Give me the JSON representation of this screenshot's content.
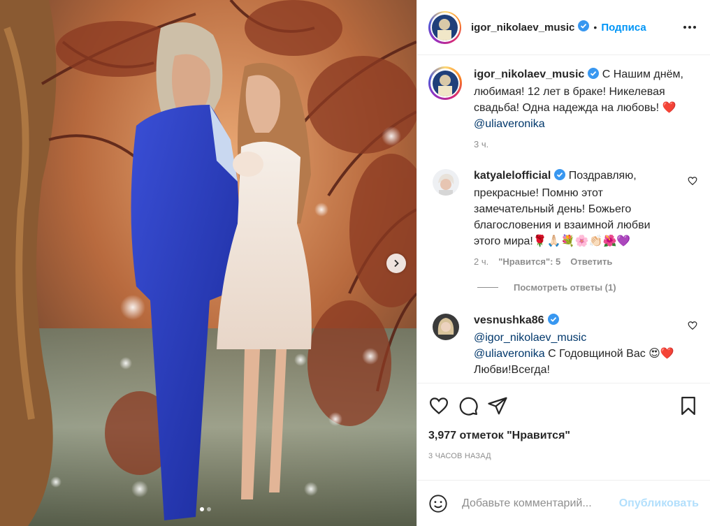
{
  "post": {
    "author": "igor_nikolaev_music",
    "follow_label": "Подписа",
    "bullet": "•",
    "caption": {
      "username": "igor_nikolaev_music",
      "text": " С Нашим днём, любимая! 12 лет в браке! Никелевая свадьба! Одна надежда на любовь! ❤️ ",
      "mention": "@uliaveronika",
      "time": "3 ч."
    },
    "comments": [
      {
        "username": "katyalelofficial",
        "text": " Поздравляю, прекрасные! Помню этот замечательный день! Божьего благословения и взаимной любви этого мира!🌹🙏🏻💐🌸👏🏻🌺💜",
        "time": "2 ч.",
        "likes": "\"Нравится\": 5",
        "reply": "Ответить",
        "view_replies": "Посмотреть ответы (1)"
      },
      {
        "username": "vesnushka86",
        "mention1": "@igor_nikolaev_music",
        "mention2": "@uliaveronika",
        "text": " С Годовщиной Вас 😍❤️ Любви!Всегда!"
      }
    ],
    "likes_count": "3,977 отметок \"Нравится\"",
    "timestamp": "3 ЧАСОВ НАЗАД",
    "comment_placeholder": "Добавьте комментарий...",
    "publish_label": "Опубликовать",
    "carousel": {
      "total": 2,
      "current": 1
    }
  },
  "icons": {
    "verified": "verified-badge-icon",
    "like": "heart-icon",
    "comment": "comment-icon",
    "share": "paper-plane-icon",
    "save": "bookmark-icon",
    "emoji": "smiley-icon",
    "more": "more-dots-icon",
    "next": "chevron-right-icon"
  },
  "colors": {
    "link": "#0095f6",
    "mention": "#00376b",
    "muted": "#8e8e8e",
    "verified": "#3897f0",
    "publish_disabled": "#b2dffc"
  }
}
